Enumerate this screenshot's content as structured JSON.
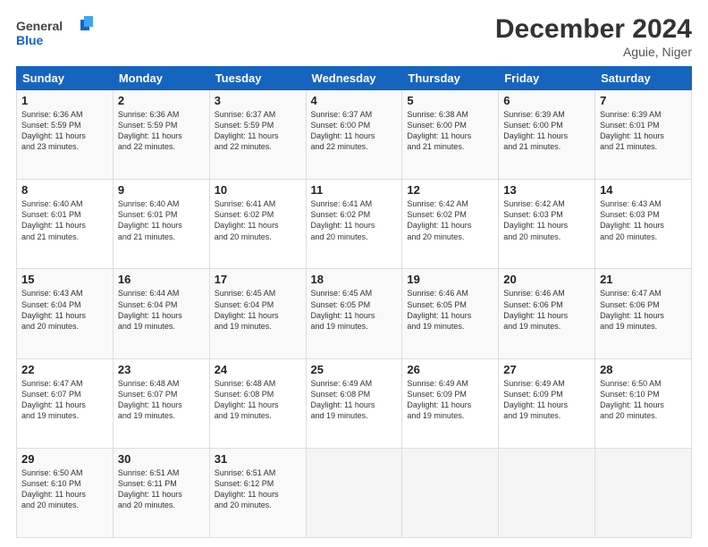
{
  "logo": {
    "general": "General",
    "blue": "Blue"
  },
  "header": {
    "title": "December 2024",
    "location": "Aguie, Niger"
  },
  "days_of_week": [
    "Sunday",
    "Monday",
    "Tuesday",
    "Wednesday",
    "Thursday",
    "Friday",
    "Saturday"
  ],
  "weeks": [
    [
      {
        "day": "1",
        "info": "Sunrise: 6:36 AM\nSunset: 5:59 PM\nDaylight: 11 hours\nand 23 minutes."
      },
      {
        "day": "2",
        "info": "Sunrise: 6:36 AM\nSunset: 5:59 PM\nDaylight: 11 hours\nand 22 minutes."
      },
      {
        "day": "3",
        "info": "Sunrise: 6:37 AM\nSunset: 5:59 PM\nDaylight: 11 hours\nand 22 minutes."
      },
      {
        "day": "4",
        "info": "Sunrise: 6:37 AM\nSunset: 6:00 PM\nDaylight: 11 hours\nand 22 minutes."
      },
      {
        "day": "5",
        "info": "Sunrise: 6:38 AM\nSunset: 6:00 PM\nDaylight: 11 hours\nand 21 minutes."
      },
      {
        "day": "6",
        "info": "Sunrise: 6:39 AM\nSunset: 6:00 PM\nDaylight: 11 hours\nand 21 minutes."
      },
      {
        "day": "7",
        "info": "Sunrise: 6:39 AM\nSunset: 6:01 PM\nDaylight: 11 hours\nand 21 minutes."
      }
    ],
    [
      {
        "day": "8",
        "info": "Sunrise: 6:40 AM\nSunset: 6:01 PM\nDaylight: 11 hours\nand 21 minutes."
      },
      {
        "day": "9",
        "info": "Sunrise: 6:40 AM\nSunset: 6:01 PM\nDaylight: 11 hours\nand 21 minutes."
      },
      {
        "day": "10",
        "info": "Sunrise: 6:41 AM\nSunset: 6:02 PM\nDaylight: 11 hours\nand 20 minutes."
      },
      {
        "day": "11",
        "info": "Sunrise: 6:41 AM\nSunset: 6:02 PM\nDaylight: 11 hours\nand 20 minutes."
      },
      {
        "day": "12",
        "info": "Sunrise: 6:42 AM\nSunset: 6:02 PM\nDaylight: 11 hours\nand 20 minutes."
      },
      {
        "day": "13",
        "info": "Sunrise: 6:42 AM\nSunset: 6:03 PM\nDaylight: 11 hours\nand 20 minutes."
      },
      {
        "day": "14",
        "info": "Sunrise: 6:43 AM\nSunset: 6:03 PM\nDaylight: 11 hours\nand 20 minutes."
      }
    ],
    [
      {
        "day": "15",
        "info": "Sunrise: 6:43 AM\nSunset: 6:04 PM\nDaylight: 11 hours\nand 20 minutes."
      },
      {
        "day": "16",
        "info": "Sunrise: 6:44 AM\nSunset: 6:04 PM\nDaylight: 11 hours\nand 19 minutes."
      },
      {
        "day": "17",
        "info": "Sunrise: 6:45 AM\nSunset: 6:04 PM\nDaylight: 11 hours\nand 19 minutes."
      },
      {
        "day": "18",
        "info": "Sunrise: 6:45 AM\nSunset: 6:05 PM\nDaylight: 11 hours\nand 19 minutes."
      },
      {
        "day": "19",
        "info": "Sunrise: 6:46 AM\nSunset: 6:05 PM\nDaylight: 11 hours\nand 19 minutes."
      },
      {
        "day": "20",
        "info": "Sunrise: 6:46 AM\nSunset: 6:06 PM\nDaylight: 11 hours\nand 19 minutes."
      },
      {
        "day": "21",
        "info": "Sunrise: 6:47 AM\nSunset: 6:06 PM\nDaylight: 11 hours\nand 19 minutes."
      }
    ],
    [
      {
        "day": "22",
        "info": "Sunrise: 6:47 AM\nSunset: 6:07 PM\nDaylight: 11 hours\nand 19 minutes."
      },
      {
        "day": "23",
        "info": "Sunrise: 6:48 AM\nSunset: 6:07 PM\nDaylight: 11 hours\nand 19 minutes."
      },
      {
        "day": "24",
        "info": "Sunrise: 6:48 AM\nSunset: 6:08 PM\nDaylight: 11 hours\nand 19 minutes."
      },
      {
        "day": "25",
        "info": "Sunrise: 6:49 AM\nSunset: 6:08 PM\nDaylight: 11 hours\nand 19 minutes."
      },
      {
        "day": "26",
        "info": "Sunrise: 6:49 AM\nSunset: 6:09 PM\nDaylight: 11 hours\nand 19 minutes."
      },
      {
        "day": "27",
        "info": "Sunrise: 6:49 AM\nSunset: 6:09 PM\nDaylight: 11 hours\nand 19 minutes."
      },
      {
        "day": "28",
        "info": "Sunrise: 6:50 AM\nSunset: 6:10 PM\nDaylight: 11 hours\nand 20 minutes."
      }
    ],
    [
      {
        "day": "29",
        "info": "Sunrise: 6:50 AM\nSunset: 6:10 PM\nDaylight: 11 hours\nand 20 minutes."
      },
      {
        "day": "30",
        "info": "Sunrise: 6:51 AM\nSunset: 6:11 PM\nDaylight: 11 hours\nand 20 minutes."
      },
      {
        "day": "31",
        "info": "Sunrise: 6:51 AM\nSunset: 6:12 PM\nDaylight: 11 hours\nand 20 minutes."
      },
      {
        "day": "",
        "info": ""
      },
      {
        "day": "",
        "info": ""
      },
      {
        "day": "",
        "info": ""
      },
      {
        "day": "",
        "info": ""
      }
    ]
  ]
}
